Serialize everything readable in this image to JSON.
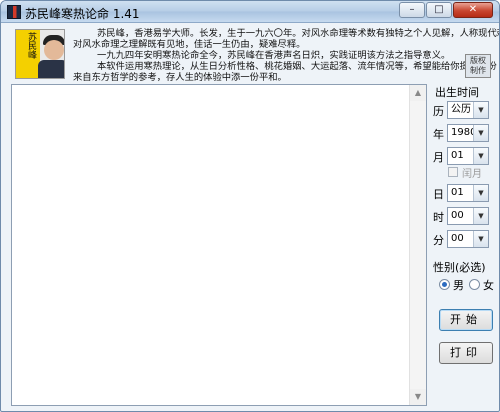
{
  "window": {
    "title": "苏民峰寒热论命 1.41",
    "controls": {
      "minimize": "–",
      "maximize": "□",
      "close": "✕"
    }
  },
  "header": {
    "portrait_caption": "苏民峰",
    "intro_lines": [
      "苏民峰，香港易学大师。长发，生于一九六〇年。对风水命理等术数有独特之个人见解，人称现代赖布衣，",
      "对风水命理之理解既有见地，佳话一生仍由，疑难尽释。",
      "一九九四年安明寒热论命全今，苏民峰在香港声名日炽，实践证明该方法之指导意义。",
      "本软件运用寒热理论，从生日分析性格、桃花婚姻、大运起落、流年情况等，希望能给你提供一份",
      "来自东方哲学的参考，存人生的体验中添一份平和。"
    ],
    "copyright_button": "版权\n制作"
  },
  "birth_panel": {
    "heading": "出生时间",
    "calendar_label": "历",
    "calendar_value": "公历",
    "year_label": "年",
    "year_value": "1980",
    "month_label": "月",
    "month_value": "01",
    "leap_month_label": "闰月",
    "day_label": "日",
    "day_value": "01",
    "hour_label": "时",
    "hour_value": "00",
    "minute_label": "分",
    "minute_value": "00",
    "gender_heading": "性别(必选)",
    "male_label": "男",
    "female_label": "女",
    "start_button": "开始",
    "print_button": "打印"
  }
}
